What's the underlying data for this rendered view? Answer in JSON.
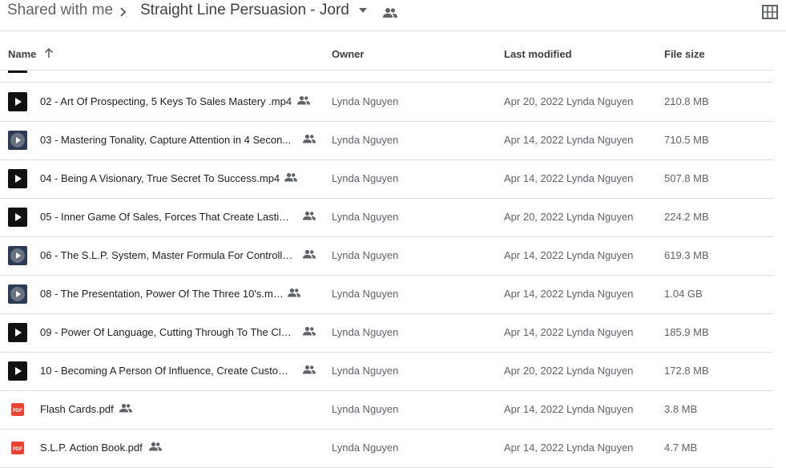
{
  "breadcrumb": {
    "root": "Shared with me",
    "current": "Straight Line Persuasion - Jord..."
  },
  "columns": {
    "name": "Name",
    "owner": "Owner",
    "last_modified": "Last modified",
    "file_size": "File size"
  },
  "files": [
    {
      "name": "02 - Art Of Prospecting, 5 Keys To Sales Mastery .mp4",
      "owner": "Lynda Nguyen",
      "modified": "Apr 20, 2022 Lynda Nguyen",
      "size": "210.8 MB",
      "icon": "video-play-icon"
    },
    {
      "name": "03 - Mastering Tonality, Capture Attention in 4 Secon...",
      "owner": "Lynda Nguyen",
      "modified": "Apr 14, 2022 Lynda Nguyen",
      "size": "710.5 MB",
      "icon": "video-thumbnail-icon"
    },
    {
      "name": "04 - Being A Visionary, True Secret To Success.mp4",
      "owner": "Lynda Nguyen",
      "modified": "Apr 14, 2022 Lynda Nguyen",
      "size": "507.8 MB",
      "icon": "video-play-icon"
    },
    {
      "name": "05 - Inner Game Of Sales, Forces That Create Lasting ...",
      "owner": "Lynda Nguyen",
      "modified": "Apr 20, 2022 Lynda Nguyen",
      "size": "224.2 MB",
      "icon": "video-play-icon"
    },
    {
      "name": "06 - The S.L.P. System, Master Formula For Controllin...",
      "owner": "Lynda Nguyen",
      "modified": "Apr 14, 2022 Lynda Nguyen",
      "size": "619.3 MB",
      "icon": "video-thumbnail-icon"
    },
    {
      "name": "08 - The Presentation, Power Of The Three 10's.mp4",
      "owner": "Lynda Nguyen",
      "modified": "Apr 14, 2022 Lynda Nguyen",
      "size": "1.04 GB",
      "icon": "video-thumbnail-icon"
    },
    {
      "name": "09 - Power Of Language, Cutting Through To The Clos...",
      "owner": "Lynda Nguyen",
      "modified": "Apr 14, 2022 Lynda Nguyen",
      "size": "185.9 MB",
      "icon": "video-play-icon"
    },
    {
      "name": "10 - Becoming A Person Of Influence, Create Custom...",
      "owner": "Lynda Nguyen",
      "modified": "Apr 20, 2022 Lynda Nguyen",
      "size": "172.8 MB",
      "icon": "video-play-icon"
    },
    {
      "name": "Flash Cards.pdf",
      "owner": "Lynda Nguyen",
      "modified": "Apr 14, 2022 Lynda Nguyen",
      "size": "3.8 MB",
      "icon": "pdf-icon"
    },
    {
      "name": "S.L.P. Action Book.pdf",
      "owner": "Lynda Nguyen",
      "modified": "Apr 14, 2022 Lynda Nguyen",
      "size": "4.7 MB",
      "icon": "pdf-icon"
    }
  ],
  "pdf_badge": "PDF",
  "colors": {
    "pdf_red": "#ea4335",
    "divider": "#dadce0",
    "text": "#3c4043"
  }
}
